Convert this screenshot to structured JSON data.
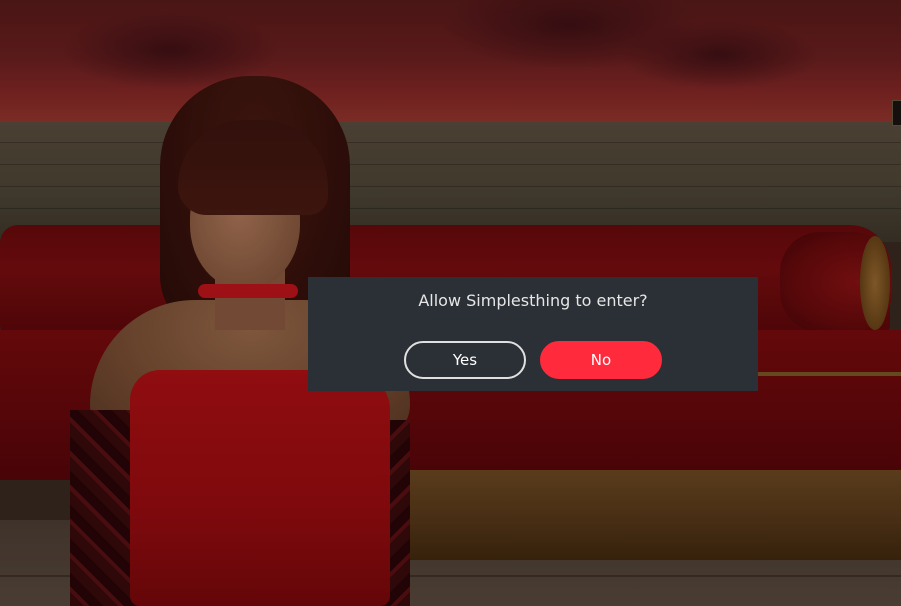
{
  "dialog": {
    "message": "Allow Simplesthing to enter?",
    "yes_label": "Yes",
    "no_label": "No"
  },
  "colors": {
    "dialog_background": "#2b3036",
    "no_button": "#ff2a3c",
    "yes_border": "#e0e0e0",
    "text": "#e6e6e6"
  },
  "icons": {
    "hud_corner": "lantern-icon"
  }
}
